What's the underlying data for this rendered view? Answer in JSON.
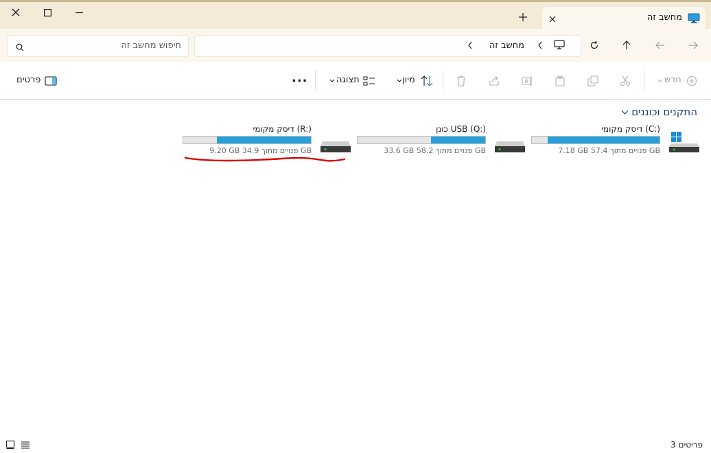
{
  "window": {
    "tab_title": "מחשב זה",
    "tab_icon": "monitor-icon",
    "new_tab_icon": "plus-icon"
  },
  "address": {
    "search_placeholder": "חיפוש מחשב זה",
    "breadcrumbs": [
      "מחשב זה"
    ]
  },
  "toolbar": {
    "new_label": "חדש",
    "sort_label": "מיון",
    "view_label": "תצוגה",
    "details_label": "פרטים",
    "more_label": "..."
  },
  "main": {
    "group_title": "התקנים וכוננים",
    "drives": [
      {
        "name": "דיסק מקומי (C:)",
        "space": "7.18 GB פנויים מתוך 57.4 GB",
        "used_fraction": 0.875,
        "icon": "hdd-windows-icon"
      },
      {
        "name": "כונן USB (Q:)",
        "space": "33.6 GB פנויים מתוך 58.2 GB",
        "used_fraction": 0.423,
        "icon": "hdd-icon"
      },
      {
        "name": "דיסק מקומי (R:)",
        "space": "9.20 GB פנויים מתוך 34.9 GB",
        "used_fraction": 0.736,
        "icon": "hdd-icon"
      }
    ]
  },
  "status": {
    "item_count": "3 פריטים"
  },
  "colors": {
    "accent": "#26a0da",
    "title_bg": "#f3ead8",
    "group_header": "#1f3a78",
    "annotation": "#d90000"
  }
}
